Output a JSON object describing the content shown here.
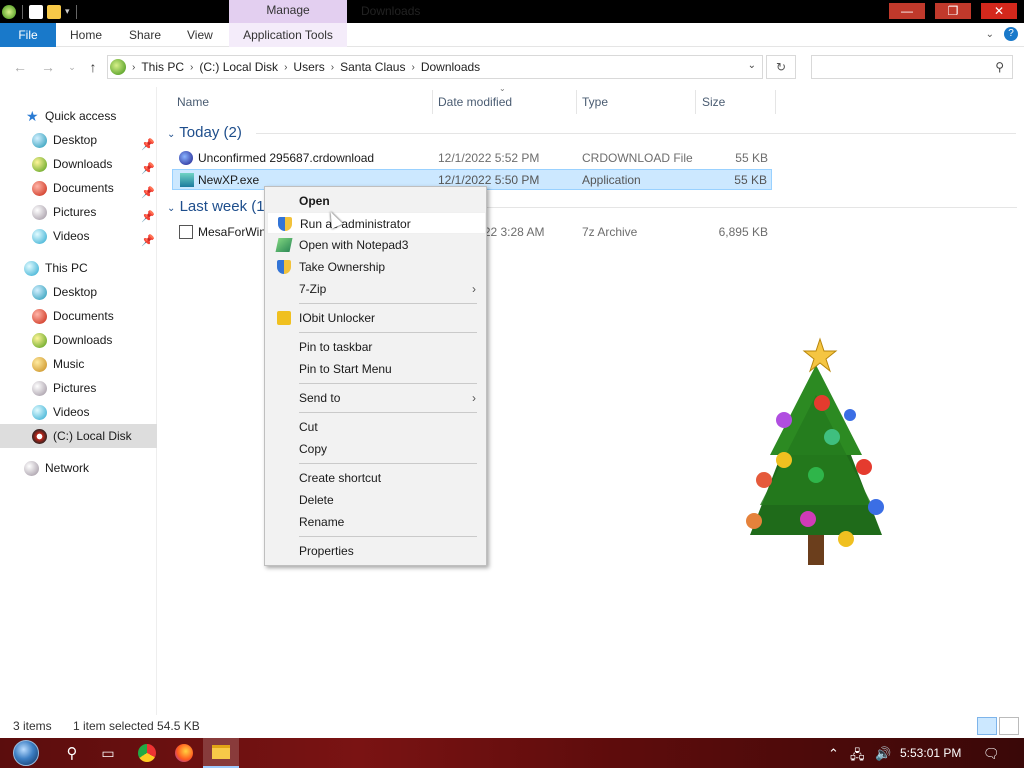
{
  "window": {
    "title": "Downloads",
    "context_tab": "Manage"
  },
  "ribbon": {
    "tabs": [
      "File",
      "Home",
      "Share",
      "View",
      "Application Tools"
    ]
  },
  "address": {
    "crumbs": [
      "This PC",
      "(C:) Local Disk",
      "Users",
      "Santa Claus",
      "Downloads"
    ],
    "search_placeholder": ""
  },
  "navpane": {
    "quick_access": "Quick access",
    "quick_items": [
      "Desktop",
      "Downloads",
      "Documents",
      "Pictures",
      "Videos"
    ],
    "this_pc": "This PC",
    "pc_items": [
      "Desktop",
      "Documents",
      "Downloads",
      "Music",
      "Pictures",
      "Videos",
      "(C:) Local Disk"
    ],
    "network": "Network"
  },
  "columns": {
    "name": "Name",
    "date": "Date modified",
    "type": "Type",
    "size": "Size"
  },
  "groups": {
    "today": "Today (2)",
    "lastweek": "Last week (1)"
  },
  "files": [
    {
      "name": "Unconfirmed 295687.crdownload",
      "date": "12/1/2022 5:52 PM",
      "type": "CRDOWNLOAD File",
      "size": "55 KB"
    },
    {
      "name": "NewXP.exe",
      "date": "12/1/2022 5:50 PM",
      "type": "Application",
      "size": "55 KB"
    },
    {
      "name": "MesaForWindows-x64-22.2.3.7z",
      "date": "11/25/2022 3:28 AM",
      "type": "7z Archive",
      "size": "6,895 KB"
    }
  ],
  "context_menu": {
    "open": "Open",
    "run_as_admin": "Run as administrator",
    "open_notepad3": "Open with Notepad3",
    "take_ownership": "Take Ownership",
    "seven_zip": "7-Zip",
    "iobit": "IObit Unlocker",
    "pin_taskbar": "Pin to taskbar",
    "pin_start": "Pin to Start Menu",
    "send_to": "Send to",
    "cut": "Cut",
    "copy": "Copy",
    "create_shortcut": "Create shortcut",
    "delete": "Delete",
    "rename": "Rename",
    "properties": "Properties"
  },
  "status": {
    "items": "3 items",
    "selected": "1 item selected  54.5 KB"
  },
  "taskbar": {
    "clock": "5:53:01 PM"
  },
  "colors": {
    "accent": "#1979ca",
    "selection": "#cce8ff",
    "manage_tab": "#e3cff0",
    "taskbar": "#7a1313"
  }
}
